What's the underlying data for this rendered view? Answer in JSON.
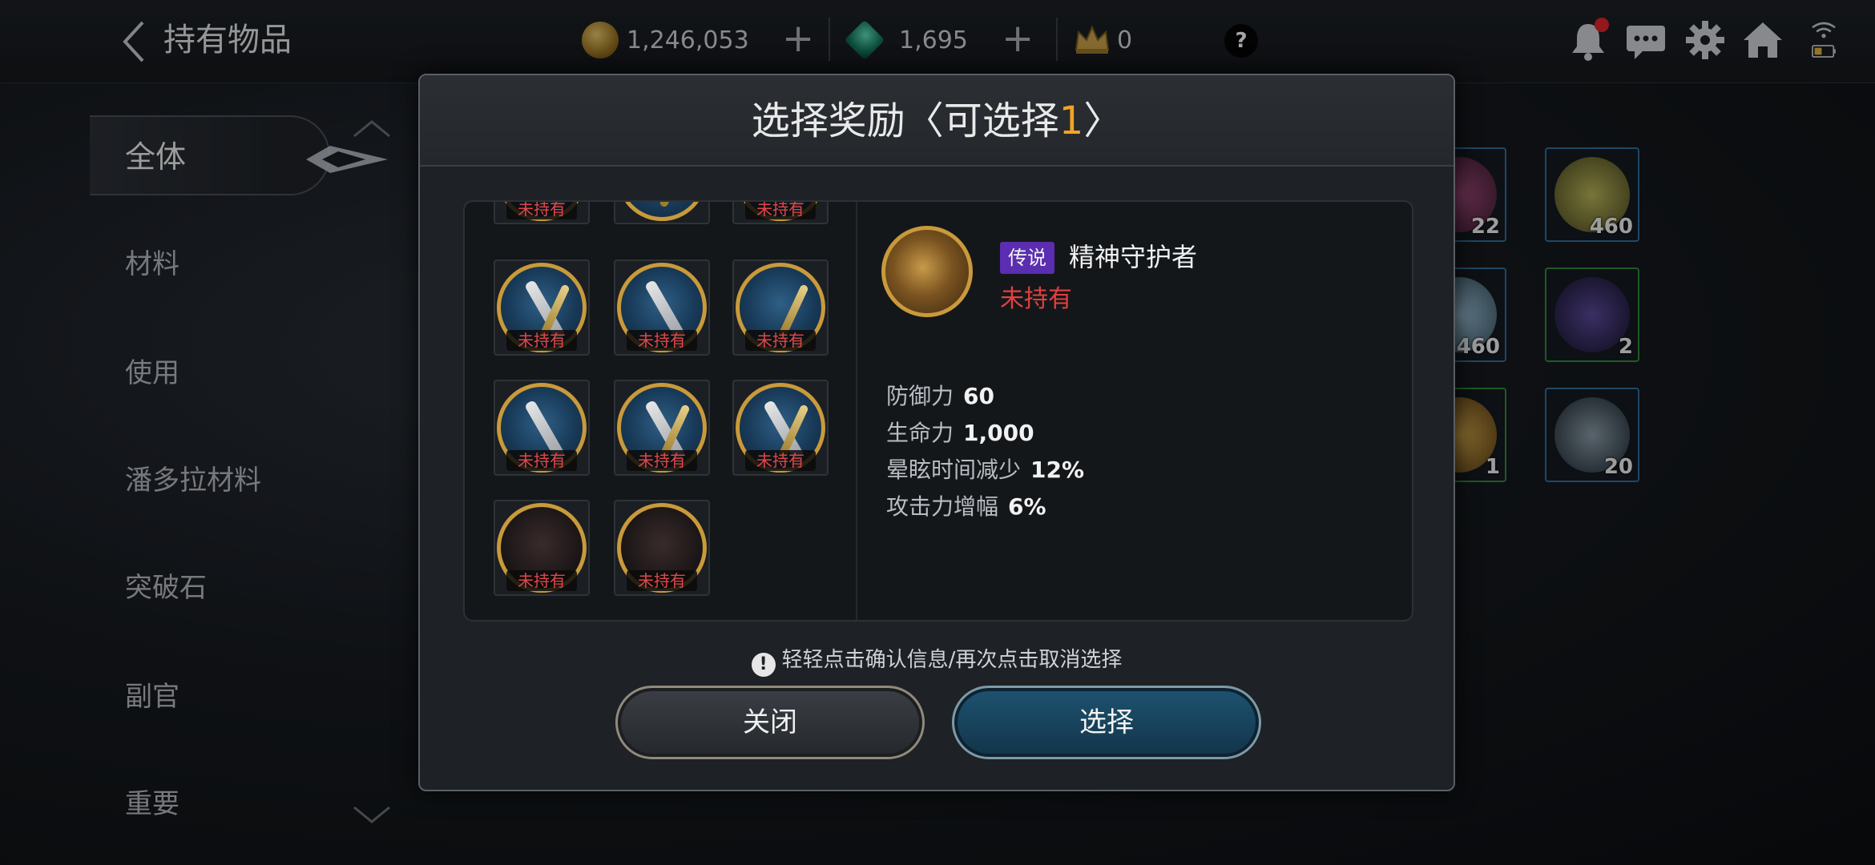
{
  "topbar": {
    "back_icon": "back-arrow-icon",
    "title": "持有物品",
    "gold": "1,246,053",
    "gem": "1,695",
    "crown": "0",
    "help": "?",
    "plus": "+"
  },
  "sidebar": {
    "items": [
      "全体",
      "材料",
      "使用",
      "潘多拉材料",
      "突破石",
      "副官",
      "重要"
    ]
  },
  "inventory": {
    "slots": [
      {
        "count": "22",
        "color": "blue"
      },
      {
        "count": "460",
        "color": "blue"
      },
      {
        "count": "460",
        "color": "blue"
      },
      {
        "count": "2",
        "color": "green"
      },
      {
        "count": "1",
        "color": "green"
      },
      {
        "count": "20",
        "color": "blue"
      }
    ]
  },
  "modal": {
    "title_prefix": "选择奖励〈可选择",
    "title_count": "1",
    "title_suffix": "〉",
    "not_owned_badge": "未持有",
    "rewards": [
      "未持有",
      "未持有",
      "未持有",
      "未持有",
      "未持有",
      "未持有",
      "未持有",
      "未持有",
      "未持有",
      "未持有",
      "未持有"
    ],
    "detail": {
      "rarity": "传说",
      "name": "精神守护者",
      "status": "未持有",
      "stats": [
        {
          "label": "防御力",
          "value": "60"
        },
        {
          "label": "生命力",
          "value": "1,000"
        },
        {
          "label": "晕眩时间减少",
          "value": "12%"
        },
        {
          "label": "攻击力增幅",
          "value": "6%"
        }
      ]
    },
    "hint": "轻轻点击确认信息/再次点击取消选择",
    "hint_icon": "!",
    "close_label": "关闭",
    "select_label": "选择"
  },
  "colors": {
    "accent_gold": "#f2a324",
    "not_owned_red": "#e3403f",
    "legendary_purple": "#5b2db0"
  }
}
